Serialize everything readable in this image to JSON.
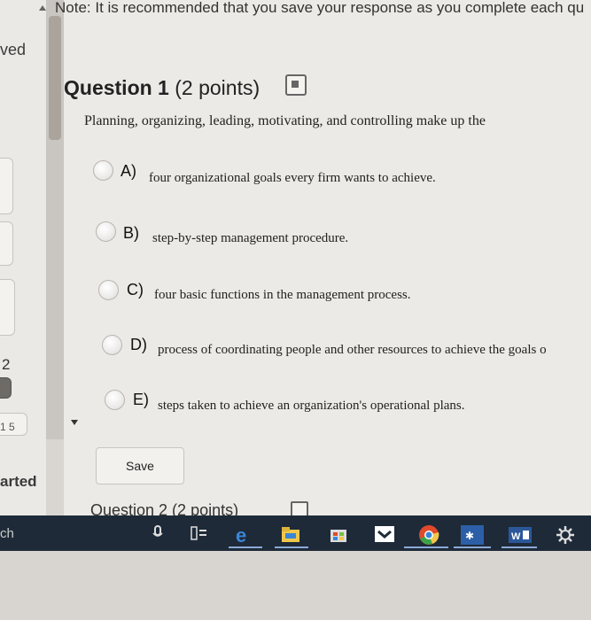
{
  "note": "Note: It is recommended that you save your response as you complete each qu",
  "sidebar": {
    "saved_fragment": "ved",
    "number_fragment": "2",
    "small_fragment": "1 5",
    "started_fragment": "arted"
  },
  "question": {
    "number_label": "Question 1",
    "points_label": "(2 points)",
    "text": "Planning, organizing, leading, motivating, and controlling make up the",
    "choices": [
      {
        "letter": "A)",
        "text": "four organizational goals every firm wants to achieve."
      },
      {
        "letter": "B)",
        "text": "step-by-step management procedure."
      },
      {
        "letter": "C)",
        "text": "four basic functions in the management process."
      },
      {
        "letter": "D)",
        "text": "process of coordinating people and other resources to achieve the goals o"
      },
      {
        "letter": "E)",
        "text": "steps taken to achieve an organization's operational plans."
      }
    ]
  },
  "save_label": "Save",
  "next_question_fragment": "Question 2 (2 points)",
  "taskbar": {
    "left_fragment": "ch",
    "icons": [
      "microphone-icon",
      "task-view-icon",
      "edge-icon",
      "file-explorer-icon",
      "store-icon",
      "send-icon",
      "chrome-icon",
      "app-icon",
      "word-icon",
      "settings-icon"
    ]
  },
  "colors": {
    "background": "#eceae6",
    "taskbar": "#1e2a38",
    "text": "#222222"
  }
}
